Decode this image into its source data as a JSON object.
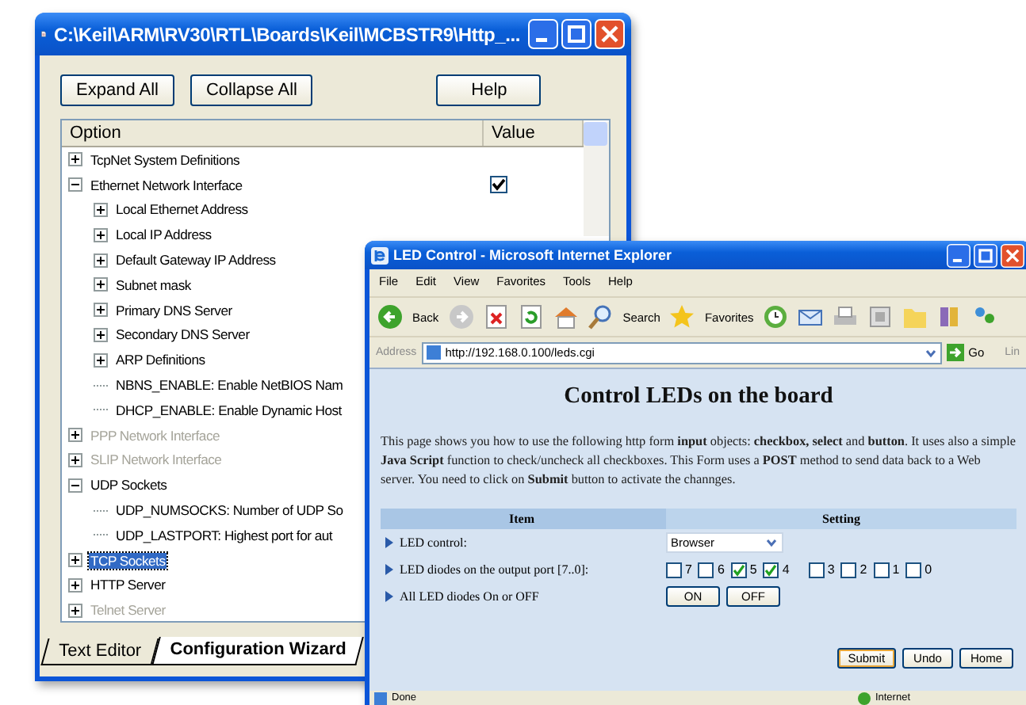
{
  "config_window": {
    "title": "C:\\Keil\\ARM\\RV30\\RTL\\Boards\\Keil\\MCBSTR9\\Http_...",
    "buttons": [
      "Expand All",
      "Collapse All",
      "Help"
    ],
    "columns": [
      "Option",
      "Value"
    ],
    "tree": [
      {
        "label": "TcpNet System Definitions",
        "expanded": false,
        "disabled": false,
        "selected": false
      },
      {
        "label": "Ethernet Network Interface",
        "expanded": true,
        "disabled": false,
        "selected": false,
        "checkbox": {
          "checked": true
        },
        "children": [
          {
            "label": "Local Ethernet Address",
            "expanded": false,
            "disabled": false,
            "selected": false
          },
          {
            "label": "Local IP Address",
            "expanded": false,
            "disabled": false,
            "selected": false
          },
          {
            "label": "Default Gateway IP Address",
            "expanded": false,
            "disabled": false,
            "selected": false
          },
          {
            "label": "Subnet mask",
            "expanded": false,
            "disabled": false,
            "selected": false
          },
          {
            "label": "Primary DNS Server",
            "expanded": false,
            "disabled": false,
            "selected": false
          },
          {
            "label": "Secondary DNS Server",
            "expanded": false,
            "disabled": false,
            "selected": false
          },
          {
            "label": "ARP Definitions",
            "expanded": false,
            "disabled": false,
            "selected": false
          },
          {
            "label": "NBNS_ENABLE: Enable NetBIOS Nam",
            "disabled": false,
            "selected": false
          },
          {
            "label": "DHCP_ENABLE: Enable Dynamic Host",
            "disabled": false,
            "selected": false
          }
        ]
      },
      {
        "label": "PPP Network Interface",
        "expanded": false,
        "disabled": true,
        "selected": false
      },
      {
        "label": "SLIP Network Interface",
        "expanded": false,
        "disabled": true,
        "selected": false
      },
      {
        "label": "UDP Sockets",
        "expanded": true,
        "disabled": false,
        "selected": false,
        "children": [
          {
            "label": "UDP_NUMSOCKS: Number of UDP So",
            "disabled": false,
            "selected": false
          },
          {
            "label": "UDP_LASTPORT: Highest port for aut",
            "disabled": false,
            "selected": false
          }
        ]
      },
      {
        "label": "TCP Sockets",
        "expanded": false,
        "disabled": false,
        "selected": true
      },
      {
        "label": "HTTP Server",
        "expanded": false,
        "disabled": false,
        "selected": false
      },
      {
        "label": "Telnet Server",
        "expanded": false,
        "disabled": true,
        "selected": false
      }
    ],
    "tabs": [
      {
        "label": "Text Editor",
        "selected": false
      },
      {
        "label": "Configuration Wizard",
        "selected": true
      }
    ]
  },
  "browser_window": {
    "title": "LED Control - Microsoft Internet Explorer",
    "menu": [
      "File",
      "Edit",
      "View",
      "Favorites",
      "Tools",
      "Help"
    ],
    "toolbar": {
      "back": "Back",
      "search": "Search",
      "favorites": "Favorites"
    },
    "address": {
      "label": "Address",
      "value": "http://192.168.0.100/leds.cgi",
      "go": "Go",
      "links": "Lin"
    },
    "page": {
      "heading": "Control LEDs on the board",
      "intro": "This page shows you how to use the following http form **input** objects: **checkbox, select** and **button**. It uses also a simple **Java Script** function to check/uncheck all checkboxes. This Form uses a **POST** method to send data back to a Web server. You need to click on **Submit** button to activate the channges.",
      "columns": [
        "Item",
        "Setting"
      ],
      "rows": [
        {
          "kind": "select",
          "label": "LED control:",
          "value": "Browser"
        },
        {
          "kind": "checkboxes",
          "label": "LED diodes on the output port [7..0]:",
          "boxes": [
            {
              "label": "7",
              "checked": false
            },
            {
              "label": "6",
              "checked": false
            },
            {
              "label": "5",
              "checked": true
            },
            {
              "label": "4",
              "checked": true
            },
            {
              "label": "3",
              "checked": false
            },
            {
              "label": "2",
              "checked": false
            },
            {
              "label": "1",
              "checked": false
            },
            {
              "label": "0",
              "checked": false
            }
          ]
        },
        {
          "kind": "buttons",
          "label": "All LED diodes On or OFF",
          "buttons": [
            "ON",
            "OFF"
          ]
        }
      ],
      "buttons": [
        {
          "label": "Submit",
          "focused": true
        },
        {
          "label": "Undo",
          "focused": false
        },
        {
          "label": "Home",
          "focused": false
        }
      ]
    },
    "status_bar": {
      "text": "Done",
      "zone": "Internet"
    }
  }
}
